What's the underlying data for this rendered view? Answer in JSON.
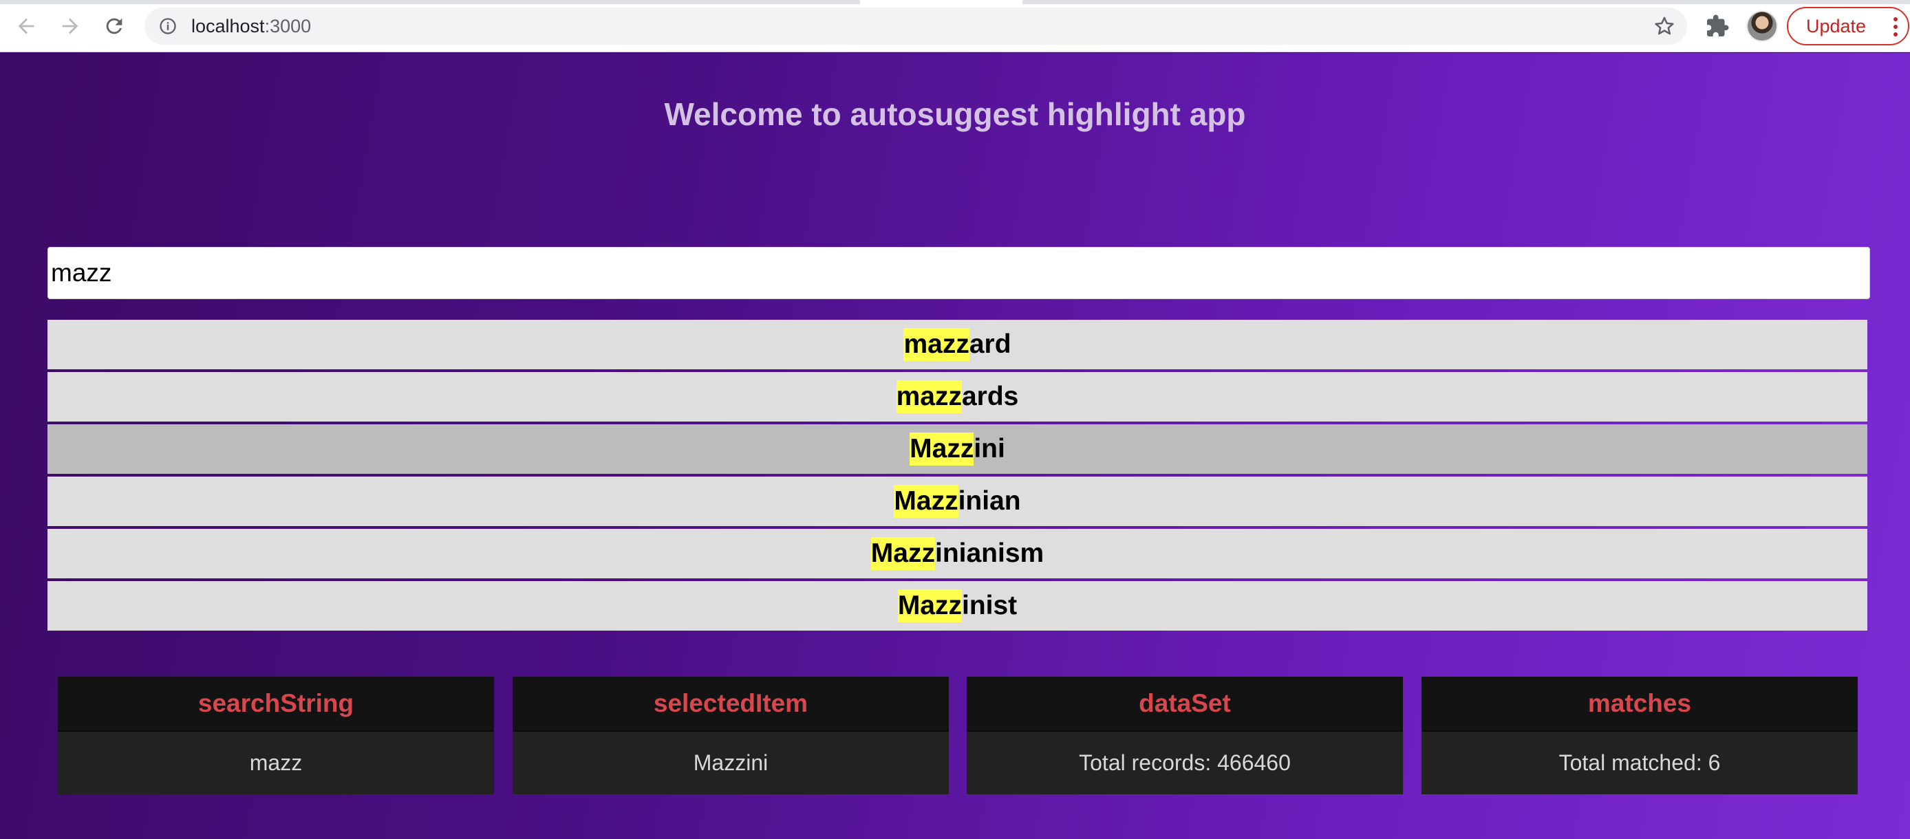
{
  "browser": {
    "url_host": "localhost",
    "url_port": ":3000",
    "update_label": "Update"
  },
  "app": {
    "title": "Welcome to autosuggest highlight app",
    "search": {
      "value": "mazz"
    },
    "suggestions": [
      {
        "match": "mazz",
        "rest": "ard",
        "selected": false
      },
      {
        "match": "mazz",
        "rest": "ards",
        "selected": false
      },
      {
        "match": "Mazz",
        "rest": "ini",
        "selected": true
      },
      {
        "match": "Mazz",
        "rest": "inian",
        "selected": false
      },
      {
        "match": "Mazz",
        "rest": "inianism",
        "selected": false
      },
      {
        "match": "Mazz",
        "rest": "inist",
        "selected": false
      }
    ],
    "cards": [
      {
        "title": "searchString",
        "value": "mazz"
      },
      {
        "title": "selectedItem",
        "value": "Mazzini"
      },
      {
        "title": "dataSet",
        "value": "Total records: 466460"
      },
      {
        "title": "matches",
        "value": "Total matched: 6"
      }
    ],
    "colors": {
      "highlight": "#ffff4d",
      "card_title": "#d8474d",
      "selected_row": "#bcbcbc"
    }
  },
  "icons": [
    "back-arrow-icon",
    "forward-arrow-icon",
    "reload-icon",
    "info-icon",
    "star-icon",
    "extension-puzzle-icon",
    "more-vert-icon"
  ]
}
